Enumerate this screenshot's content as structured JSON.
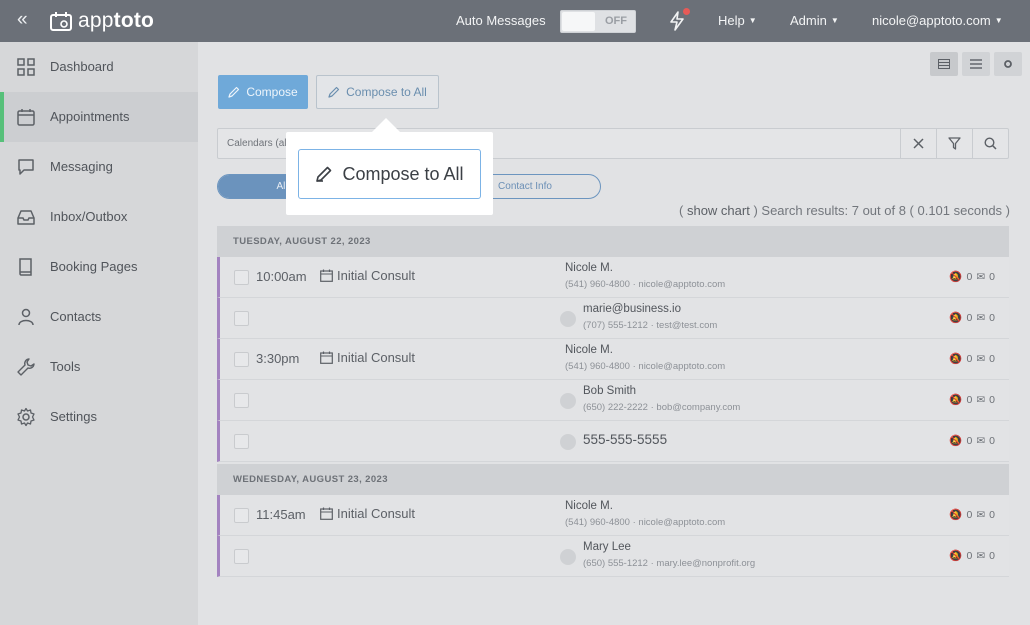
{
  "topbar": {
    "logo_text_light": "app",
    "logo_text_bold": "toto",
    "auto_messages_label": "Auto Messages",
    "auto_messages_state": "OFF",
    "help_label": "Help",
    "admin_label": "Admin",
    "user_email": "nicole@apptoto.com"
  },
  "sidebar": {
    "items": [
      {
        "label": "Dashboard",
        "icon": "grid-icon"
      },
      {
        "label": "Appointments",
        "icon": "calendar-icon",
        "active": true
      },
      {
        "label": "Messaging",
        "icon": "chat-icon"
      },
      {
        "label": "Inbox/Outbox",
        "icon": "inbox-icon"
      },
      {
        "label": "Booking Pages",
        "icon": "book-icon"
      },
      {
        "label": "Contacts",
        "icon": "person-icon"
      },
      {
        "label": "Tools",
        "icon": "wrench-icon"
      },
      {
        "label": "Settings",
        "icon": "gear-icon"
      }
    ]
  },
  "toolbar": {
    "compose_label": "Compose",
    "compose_all_label": "Compose to All"
  },
  "search": {
    "calendar_filter": "Calendars (al"
  },
  "filter_pills": {
    "all_label": "All",
    "contact_label": "Contact Info"
  },
  "results": {
    "show_chart": "show chart",
    "summary": "Search results: 7 out of 8 ( 0.101 seconds )"
  },
  "groups": [
    {
      "date": "TUESDAY, AUGUST 22, 2023",
      "rows": [
        {
          "time": "10:00am",
          "type": "Initial Consult",
          "name": "Nicole M.",
          "sub": "(541) 960-4800 · nicole@apptoto.com",
          "sms": "0",
          "email": "0"
        },
        {
          "name": "marie@business.io",
          "sub": "(707) 555-1212 · test@test.com",
          "sms": "0",
          "email": "0"
        },
        {
          "time": "3:30pm",
          "type": "Initial Consult",
          "name": "Nicole M.",
          "sub": "(541) 960-4800 · nicole@apptoto.com",
          "sms": "0",
          "email": "0"
        },
        {
          "name": "Bob Smith",
          "sub": "(650) 222-2222 · bob@company.com",
          "sms": "0",
          "email": "0"
        },
        {
          "name": "555-555-5555",
          "sub": "",
          "sms": "0",
          "email": "0"
        }
      ]
    },
    {
      "date": "WEDNESDAY, AUGUST 23, 2023",
      "rows": [
        {
          "time": "11:45am",
          "type": "Initial Consult",
          "name": "Nicole M.",
          "sub": "(541) 960-4800 · nicole@apptoto.com",
          "sms": "0",
          "email": "0"
        },
        {
          "name": "Mary Lee",
          "sub": "(650) 555-1212 · mary.lee@nonprofit.org",
          "sms": "0",
          "email": "0"
        }
      ]
    }
  ],
  "popover": {
    "label": "Compose to All"
  },
  "colors": {
    "topbar": "#6b7078",
    "accent_blue": "#6fa9d9",
    "active_green": "#57c07a",
    "row_border": "#a383c0"
  }
}
